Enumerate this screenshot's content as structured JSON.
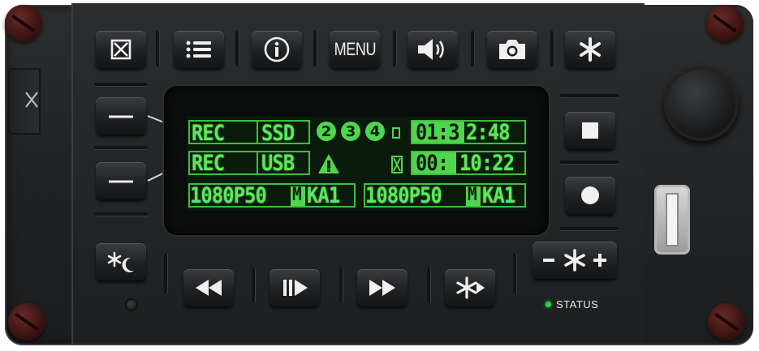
{
  "buttons": {
    "close_label": "",
    "menu_label": "MENU",
    "set1_label": "—",
    "set2_label": "—"
  },
  "lcd": {
    "row1": {
      "rec": "REC",
      "media": "SSD",
      "channels": [
        "2",
        "3",
        "4"
      ],
      "timecode_a": "01:3",
      "timecode_b": "2:48"
    },
    "row2": {
      "rec": "REC",
      "media": "USB",
      "timecode_a": "00:",
      "timecode_b": "10:22"
    },
    "row3": {
      "format_a": "1080P50",
      "mode_a": "M",
      "id_a": "KA1",
      "format_b": "1080P50",
      "mode_b": "M",
      "id_b": "KA1"
    }
  },
  "status": {
    "label": "STATUS",
    "color": "#28d43a"
  },
  "colors": {
    "lcd_green": "#5de85a",
    "lcd_bg": "#0a1a0b",
    "screw": "#4a1a17"
  },
  "icons": [
    "stop-box-icon",
    "list-icon",
    "info-icon",
    "speaker-icon",
    "camera-icon",
    "asterisk-icon",
    "square-stop-icon",
    "record-dot-icon",
    "day-night-icon",
    "rewind-icon",
    "play-pause-icon",
    "fast-forward-icon",
    "skip-icon",
    "brightness-adjust-icon"
  ]
}
